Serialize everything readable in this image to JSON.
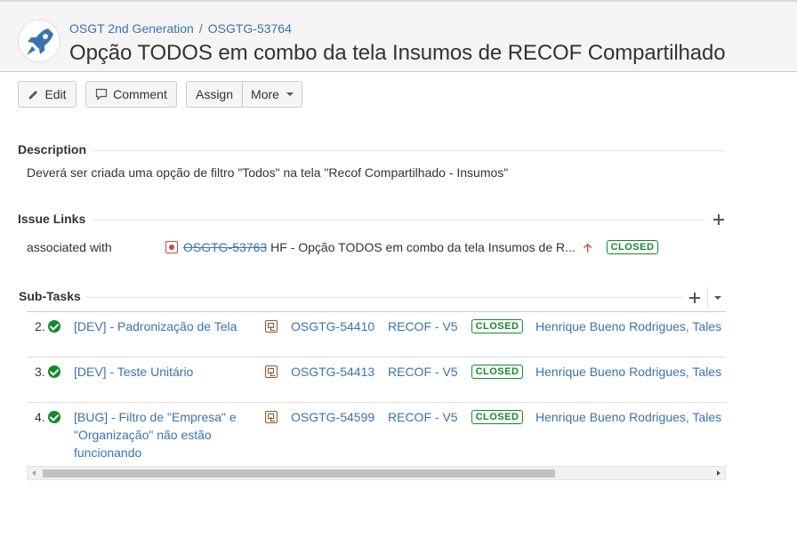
{
  "header": {
    "project_name": "OSGT 2nd Generation",
    "breadcrumb_separator": "/",
    "issue_key": "OSGTG-53764",
    "summary": "Opção TODOS em combo da tela Insumos de RECOF Compartilhado",
    "avatar_icon": "rocket-icon"
  },
  "toolbar": {
    "edit_label": "Edit",
    "comment_label": "Comment",
    "assign_label": "Assign",
    "more_label": "More"
  },
  "description": {
    "heading": "Description",
    "text": "Deverá ser criada uma opção de filtro \"Todos\" na tela \"Recof Compartilhado - Insumos\""
  },
  "issue_links": {
    "heading": "Issue Links",
    "relation": "associated with",
    "link": {
      "key": "OSGTG-53763",
      "summary": "HF - Opção TODOS em combo da tela Insumos de R...",
      "priority_icon": "arrow-up-icon",
      "status": "CLOSED"
    }
  },
  "subtasks": {
    "heading": "Sub-Tasks",
    "rows": [
      {
        "num": "2.",
        "summary_lines": [
          "[DEV] - Padronização de Tela"
        ],
        "key": "OSGTG-54410",
        "version": "RECOF - V5",
        "status": "CLOSED",
        "assignee": "Henrique Bueno Rodrigues, Tales"
      },
      {
        "num": "3.",
        "summary_lines": [
          "[DEV] - Teste Unitário"
        ],
        "key": "OSGTG-54413",
        "version": "RECOF - V5",
        "status": "CLOSED",
        "assignee": "Henrique Bueno Rodrigues, Tales"
      },
      {
        "num": "4.",
        "summary_lines": [
          "[BUG] - Filtro de \"Empresa\" e",
          "\"Organização\" não estão",
          "funcionando"
        ],
        "key": "OSGTG-54599",
        "version": "RECOF - V5",
        "status": "CLOSED",
        "assignee": "Henrique Bueno Rodrigues, Tales"
      }
    ]
  },
  "colors": {
    "link": "#3b73af",
    "closed": "#14892c",
    "priority_high": "#d04437"
  }
}
